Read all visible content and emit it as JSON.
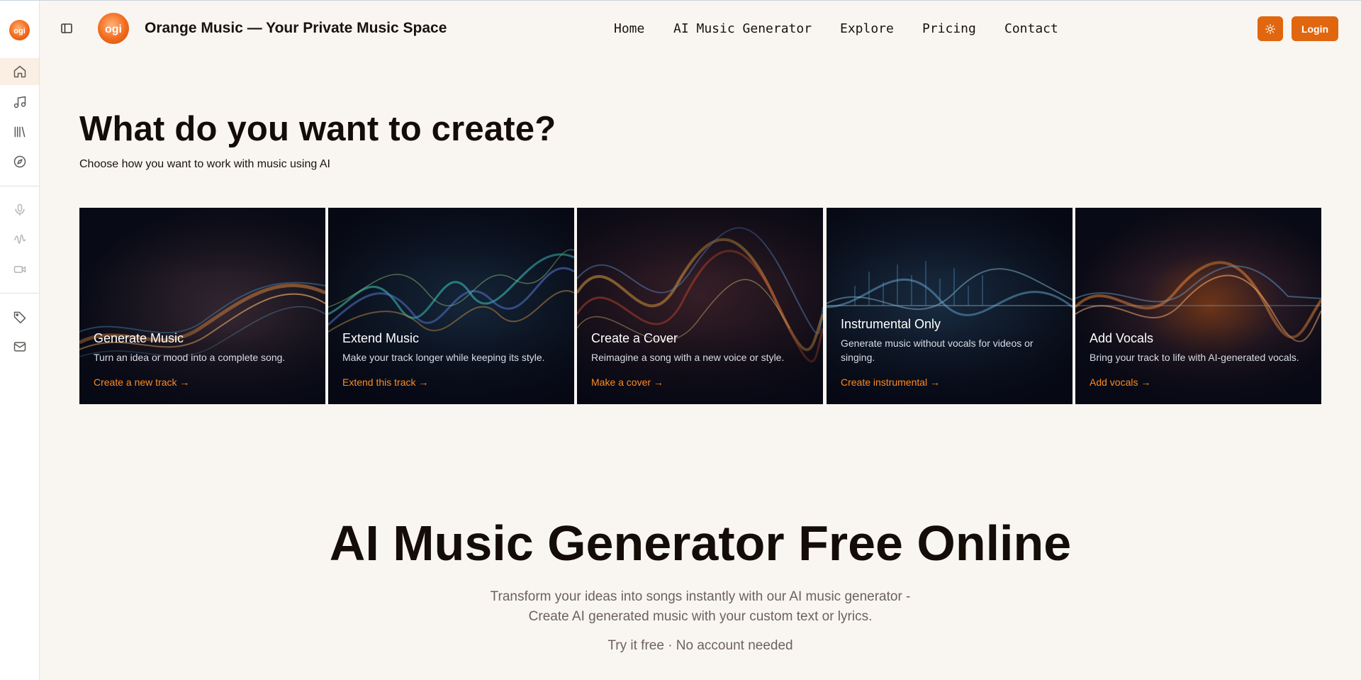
{
  "header": {
    "brand_title": "Orange Music — Your Private Music Space",
    "nav": [
      "Home",
      "AI Music Generator",
      "Explore",
      "Pricing",
      "Contact"
    ],
    "login_label": "Login",
    "theme_icon": "sun-icon",
    "accent_color": "#e0670f"
  },
  "sidebar": {
    "items": [
      {
        "icon": "home-icon",
        "active": true
      },
      {
        "icon": "music-note-icon"
      },
      {
        "icon": "library-icon"
      },
      {
        "icon": "compass-icon"
      },
      {
        "icon": "microphone-icon"
      },
      {
        "icon": "waveform-icon"
      },
      {
        "icon": "video-icon"
      },
      {
        "icon": "tag-icon"
      },
      {
        "icon": "mail-icon"
      }
    ]
  },
  "hero": {
    "title": "What do you want to create?",
    "subtitle": "Choose how you want to work with music using AI"
  },
  "cards": [
    {
      "title": "Generate Music",
      "desc": "Turn an idea or mood into a complete song.",
      "link": "Create a new track →"
    },
    {
      "title": "Extend Music",
      "desc": "Make your track longer while keeping its style.",
      "link": "Extend this track →"
    },
    {
      "title": "Create a Cover",
      "desc": "Reimagine a song with a new voice or style.",
      "link": "Make a cover →"
    },
    {
      "title": "Instrumental Only",
      "desc": "Generate music without vocals for videos or singing.",
      "link": "Create instrumental →"
    },
    {
      "title": "Add Vocals",
      "desc": "Bring your track to life with AI-generated vocals.",
      "link": "Add vocals →"
    }
  ],
  "generator": {
    "title": "AI Music Generator Free Online",
    "subtitle_line1": "Transform your ideas into songs instantly with our AI music generator -",
    "subtitle_line2": "Create AI generated music with your custom text or lyrics.",
    "note": "Try it free · No account needed"
  }
}
